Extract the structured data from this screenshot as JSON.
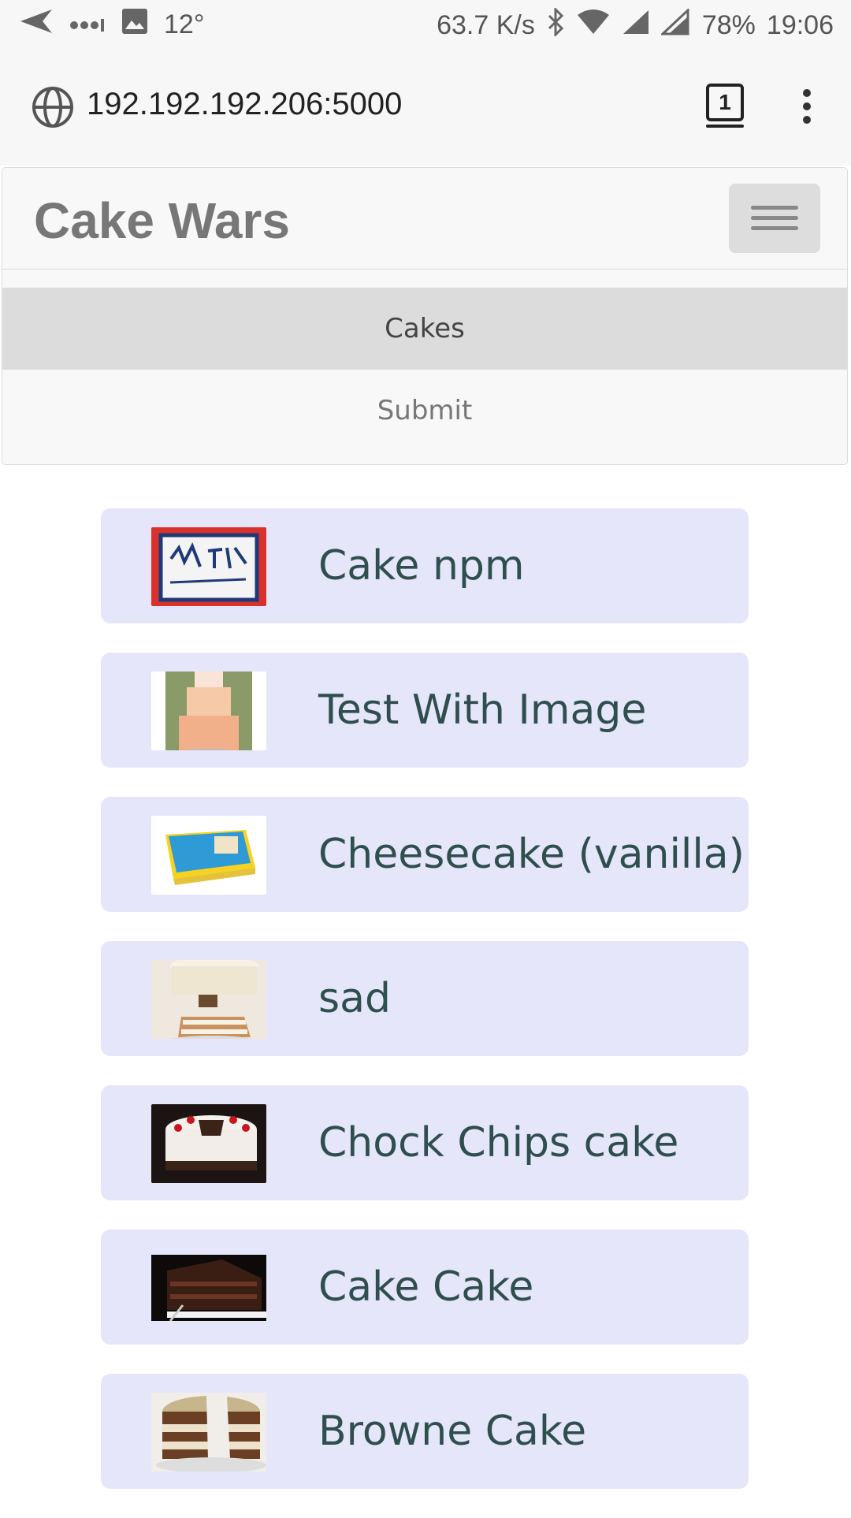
{
  "status_bar": {
    "temperature": "12°",
    "network_speed": "63.7 K/s",
    "battery": "78%",
    "time": "19:06",
    "icons": [
      "send-icon",
      "dots-icon",
      "image-icon",
      "bluetooth-icon",
      "wifi-icon",
      "signal-icon",
      "signal-roaming-icon"
    ]
  },
  "browser": {
    "url": "192.192.192.206:5000",
    "tab_count": "1"
  },
  "navbar": {
    "brand": "Cake Wars",
    "items": [
      {
        "label": "Cakes",
        "active": true
      },
      {
        "label": "Submit",
        "active": false
      }
    ]
  },
  "cakes": [
    {
      "name": "Cake npm"
    },
    {
      "name": "Test With Image"
    },
    {
      "name": "Cheesecake (vanilla)"
    },
    {
      "name": "sad"
    },
    {
      "name": "Chock Chips cake"
    },
    {
      "name": "Cake Cake"
    },
    {
      "name": "Browne Cake"
    }
  ],
  "colors": {
    "card_bg": "#e6e6fa",
    "card_text": "#2f4f4f",
    "brand_text": "#777777",
    "active_nav_bg": "#dcdcdc"
  }
}
